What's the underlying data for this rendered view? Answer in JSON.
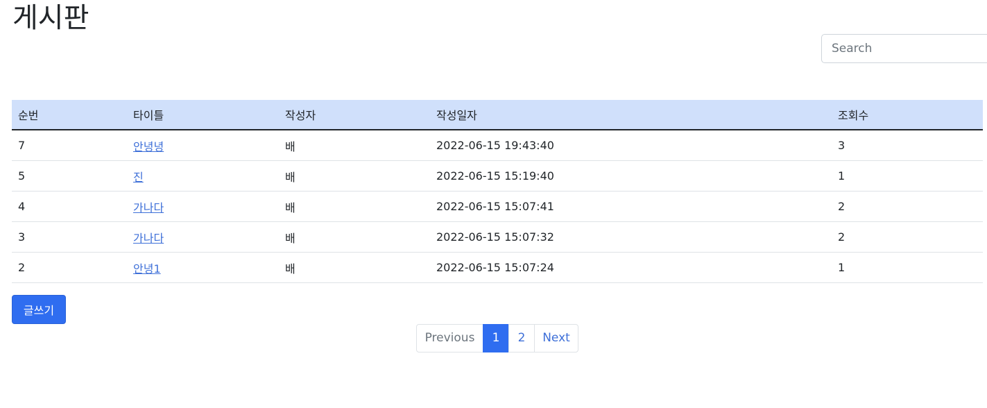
{
  "header": {
    "title": "게시판"
  },
  "search": {
    "placeholder": "Search",
    "value": ""
  },
  "table": {
    "headers": [
      "순번",
      "타이틀",
      "작성자",
      "작성일자",
      "조회수"
    ],
    "rows": [
      {
        "num": "7",
        "title": "안녕녕",
        "author": "배",
        "date": "2022-06-15 19:43:40",
        "views": "3"
      },
      {
        "num": "5",
        "title": "진",
        "author": "배",
        "date": "2022-06-15 15:19:40",
        "views": "1"
      },
      {
        "num": "4",
        "title": "가나다",
        "author": "배",
        "date": "2022-06-15 15:07:41",
        "views": "2"
      },
      {
        "num": "3",
        "title": "가나다",
        "author": "배",
        "date": "2022-06-15 15:07:32",
        "views": "2"
      },
      {
        "num": "2",
        "title": "안녕1",
        "author": "배",
        "date": "2022-06-15 15:07:24",
        "views": "1"
      }
    ]
  },
  "actions": {
    "write_label": "글쓰기"
  },
  "pagination": {
    "previous_label": "Previous",
    "pages": [
      "1",
      "2"
    ],
    "current_page": "1",
    "next_label": "Next"
  },
  "colors": {
    "accent": "#2f6df0",
    "table_header_bg": "#d0e0fb",
    "link": "#3d6fd8"
  }
}
